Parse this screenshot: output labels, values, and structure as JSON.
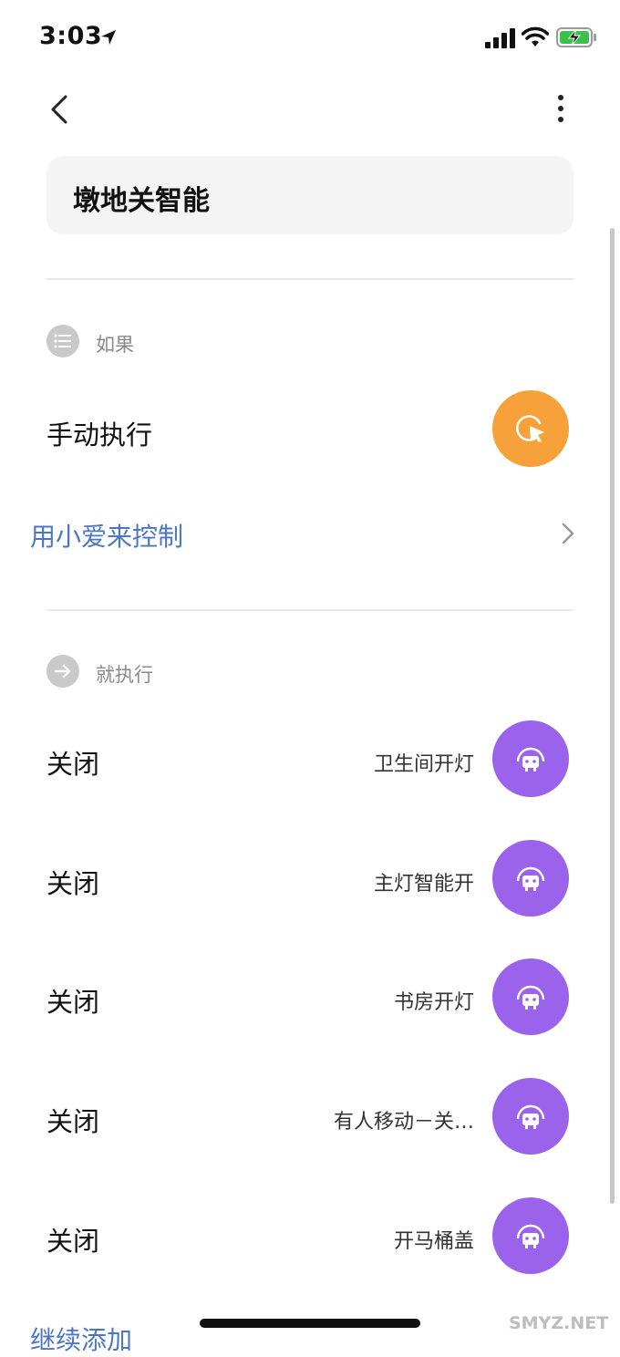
{
  "status_bar": {
    "time": "3:03"
  },
  "header": {
    "back_icon": "chevron-left-icon",
    "more_icon": "more-vertical-icon"
  },
  "scene_name": "墩地关智能",
  "if_section": {
    "label": "如果",
    "trigger_label": "手动执行",
    "trigger_icon": "cursor-click-icon",
    "voice_link": "用小爱来控制"
  },
  "then_section": {
    "label": "就执行",
    "actions": [
      {
        "action": "关闭",
        "target": "卫生间开灯"
      },
      {
        "action": "关闭",
        "target": "主灯智能开"
      },
      {
        "action": "关闭",
        "target": "书房开灯"
      },
      {
        "action": "关闭",
        "target": "有人移动－关…"
      },
      {
        "action": "关闭",
        "target": "开马桶盖"
      }
    ]
  },
  "continue_add": "继续添加",
  "watermark": "SMYZ.NET",
  "colors": {
    "accent_blue": "#4b76c4",
    "orange": "#f6a13a",
    "purple": "#9b63ec"
  }
}
